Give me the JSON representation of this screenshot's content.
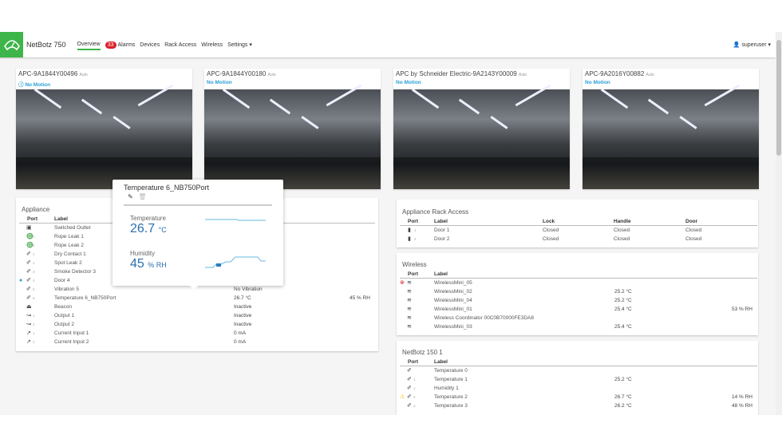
{
  "nav": {
    "brand": "NetBotz 750",
    "items": [
      "Overview",
      "Alarms",
      "Devices",
      "Rack Access",
      "Wireless",
      "Settings ▾"
    ],
    "alarm_count": "33",
    "user": "superuser ▾"
  },
  "cameras": [
    {
      "title": "APC-9A1844Y00496",
      "mode": "Auto",
      "status": "No Motion",
      "info": true
    },
    {
      "title": "APC-9A1844Y00180",
      "mode": "Auto",
      "status": "No Motion",
      "info": false
    },
    {
      "title": "APC by Schneider Electric-9A2143Y00009",
      "mode": "Auto",
      "status": "No Motion",
      "info": false
    },
    {
      "title": "APC-9A2016Y00882",
      "mode": "Auto",
      "status": "No Motion",
      "info": false
    }
  ],
  "appliance": {
    "title": "Appliance",
    "headers": [
      "Port",
      "Label"
    ],
    "rows": [
      {
        "icon": "▣",
        "port": "",
        "label": "Switched Outlet",
        "v1": "",
        "v2": ""
      },
      {
        "icon": "♎",
        "port": "1",
        "label": "Rope Leak 1",
        "v1": "",
        "v2": ""
      },
      {
        "icon": "♎",
        "port": "2",
        "label": "Rope Leak 2",
        "v1": "",
        "v2": ""
      },
      {
        "icon": "✐",
        "port": "1",
        "label": "Dry Contact 1",
        "v1": "",
        "v2": ""
      },
      {
        "icon": "✐",
        "port": "2",
        "label": "Spot Leak 2",
        "v1": "",
        "v2": ""
      },
      {
        "icon": "✐",
        "port": "3",
        "label": "Smoke Detector 3",
        "v1": "",
        "v2": ""
      },
      {
        "icon": "✐",
        "port": "4",
        "label": "Door 4",
        "v1": "",
        "v2": "",
        "status": "info"
      },
      {
        "icon": "✐",
        "port": "5",
        "label": "Vibration 5",
        "v1": "No Vibration",
        "v2": ""
      },
      {
        "icon": "✐",
        "port": "6",
        "label": "Temperature 6_NB750Port",
        "v1": "26.7 °C",
        "v2": "45 % RH"
      },
      {
        "icon": "⏏",
        "port": "",
        "label": "Beacon",
        "v1": "Inactive",
        "v2": ""
      },
      {
        "icon": "↝",
        "port": "1",
        "label": "Output 1",
        "v1": "Inactive",
        "v2": ""
      },
      {
        "icon": "↝",
        "port": "2",
        "label": "Output 2",
        "v1": "Inactive",
        "v2": ""
      },
      {
        "icon": "↗",
        "port": "1",
        "label": "Current Input 1",
        "v1": "0 mA",
        "v2": ""
      },
      {
        "icon": "↗",
        "port": "2",
        "label": "Current Input 2",
        "v1": "0 mA",
        "v2": ""
      }
    ]
  },
  "popup": {
    "title": "Temperature 6_NB750Port",
    "temp_label": "Temperature",
    "temp_value": "26.7",
    "temp_unit": "°C",
    "hum_label": "Humidity",
    "hum_value": "45",
    "hum_unit": "% RH"
  },
  "rack": {
    "title": "Appliance Rack Access",
    "headers": [
      "Port",
      "Label",
      "Lock",
      "Handle",
      "Door"
    ],
    "rows": [
      {
        "port": "1",
        "label": "Door 1",
        "lock": "Closed",
        "handle": "Closed",
        "door": "Closed"
      },
      {
        "port": "2",
        "label": "Door 2",
        "lock": "Closed",
        "handle": "Closed",
        "door": "Closed"
      }
    ]
  },
  "wireless": {
    "title": "Wireless",
    "headers": [
      "Port",
      "Label"
    ],
    "rows": [
      {
        "label": "WirelessMini_05",
        "v1": "",
        "v2": "",
        "status": "error"
      },
      {
        "label": "WirelessMini_02",
        "v1": "25.2 °C",
        "v2": ""
      },
      {
        "label": "WirelessMini_04",
        "v1": "25.2 °C",
        "v2": ""
      },
      {
        "label": "WirelessMini_01",
        "v1": "25.4 °C",
        "v2": "53 % RH"
      },
      {
        "label": "Wireless Coordinator 00C0B70000FE3DA8",
        "v1": "",
        "v2": ""
      },
      {
        "label": "WirelessMini_03",
        "v1": "25.4 °C",
        "v2": ""
      }
    ]
  },
  "netbotz150": {
    "title": "NetBotz 150 1",
    "headers": [
      "Port",
      "Label"
    ],
    "rows": [
      {
        "port": "",
        "label": "Temperature 0",
        "v1": "",
        "v2": ""
      },
      {
        "port": "1",
        "label": "Temperature 1",
        "v1": "25.2 °C",
        "v2": ""
      },
      {
        "port": "1",
        "label": "Humidity 1",
        "v1": "",
        "v2": ""
      },
      {
        "port": "2",
        "label": "Temperature 2",
        "v1": "26.7 °C",
        "v2": "14 % RH",
        "status": "warning"
      },
      {
        "port": "3",
        "label": "Temperature 3",
        "v1": "26.2 °C",
        "v2": "48 % RH"
      }
    ]
  }
}
